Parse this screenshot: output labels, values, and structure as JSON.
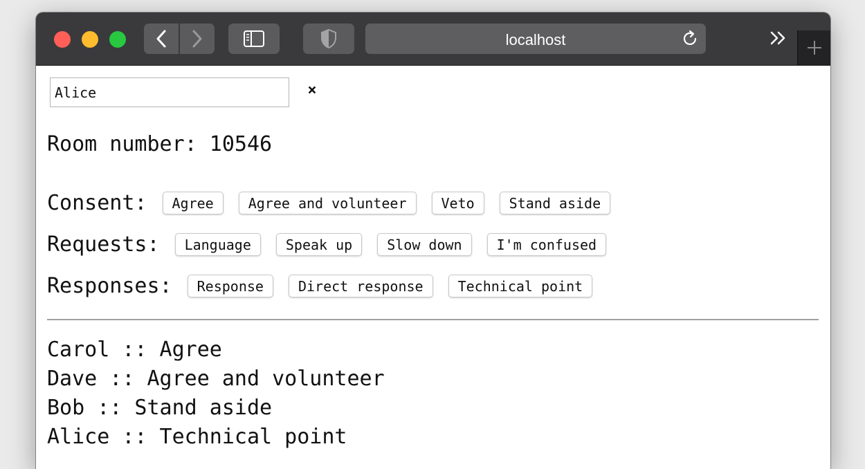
{
  "browser": {
    "url": "localhost"
  },
  "form": {
    "name_value": "Alice",
    "clear_label": "×"
  },
  "room": {
    "text": "Room number: 10546"
  },
  "consent": {
    "label": "Consent:",
    "buttons": [
      "Agree",
      "Agree and volunteer",
      "Veto",
      "Stand aside"
    ]
  },
  "requests": {
    "label": "Requests:",
    "buttons": [
      "Language",
      "Speak up",
      "Slow down",
      "I'm confused"
    ]
  },
  "responses": {
    "label": "Responses:",
    "buttons": [
      "Response",
      "Direct response",
      "Technical point"
    ]
  },
  "log": [
    "Carol :: Agree",
    "Dave :: Agree and volunteer",
    "Bob :: Stand aside",
    "Alice :: Technical point"
  ],
  "colors": {
    "titlebar": "#3a3a3c",
    "close": "#ff5f57",
    "minimize": "#febc2e",
    "zoom": "#28c840"
  }
}
